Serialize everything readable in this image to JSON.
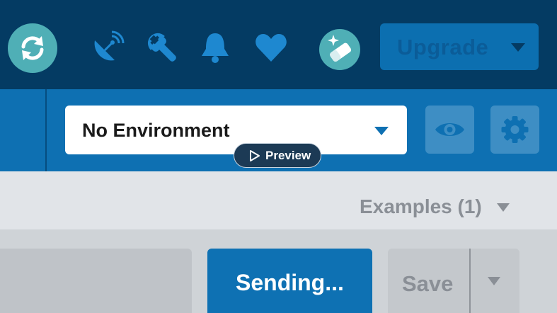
{
  "topbar": {
    "icons": [
      "sync-icon",
      "satellite-dish-icon",
      "wrench-icon",
      "bell-icon",
      "heart-icon",
      "magic-eraser-icon"
    ],
    "upgrade_label": "Upgrade"
  },
  "environment": {
    "selected": "No Environment",
    "preview_label": "Preview",
    "eye_icon": "eye-icon",
    "settings_icon": "gear-icon"
  },
  "examples": {
    "label": "Examples (1)"
  },
  "request": {
    "send_label": "Sending...",
    "save_label": "Save"
  },
  "colors": {
    "topbar": "#043b63",
    "secondbar": "#0e70b2",
    "accent_teal": "#4fafb6",
    "icon_blue": "#1e88d0",
    "send_blue": "#0e71b3"
  }
}
